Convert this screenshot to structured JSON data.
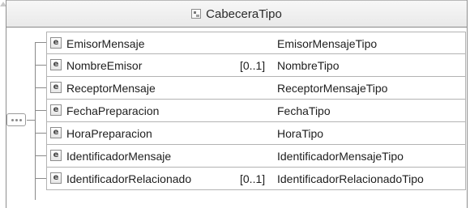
{
  "complex_type": {
    "name": "CabeceraTipo",
    "icon": "complex-type-icon"
  },
  "sequence": {
    "icon": "sequence-compositor-icon"
  },
  "elements": [
    {
      "name": "EmisorMensaje",
      "cardinality": "",
      "type": "EmisorMensajeTipo",
      "icon_letter": "e"
    },
    {
      "name": "NombreEmisor",
      "cardinality": "[0..1]",
      "type": "NombreTipo",
      "icon_letter": "e"
    },
    {
      "name": "ReceptorMensaje",
      "cardinality": "",
      "type": "ReceptorMensajeTipo",
      "icon_letter": "e"
    },
    {
      "name": "FechaPreparacion",
      "cardinality": "",
      "type": "FechaTipo",
      "icon_letter": "e"
    },
    {
      "name": "HoraPreparacion",
      "cardinality": "",
      "type": "HoraTipo",
      "icon_letter": "e"
    },
    {
      "name": "IdentificadorMensaje",
      "cardinality": "",
      "type": "IdentificadorMensajeTipo",
      "icon_letter": "e"
    },
    {
      "name": "IdentificadorRelacionado",
      "cardinality": "[0..1]",
      "type": "IdentificadorRelacionadoTipo",
      "icon_letter": "e"
    }
  ]
}
